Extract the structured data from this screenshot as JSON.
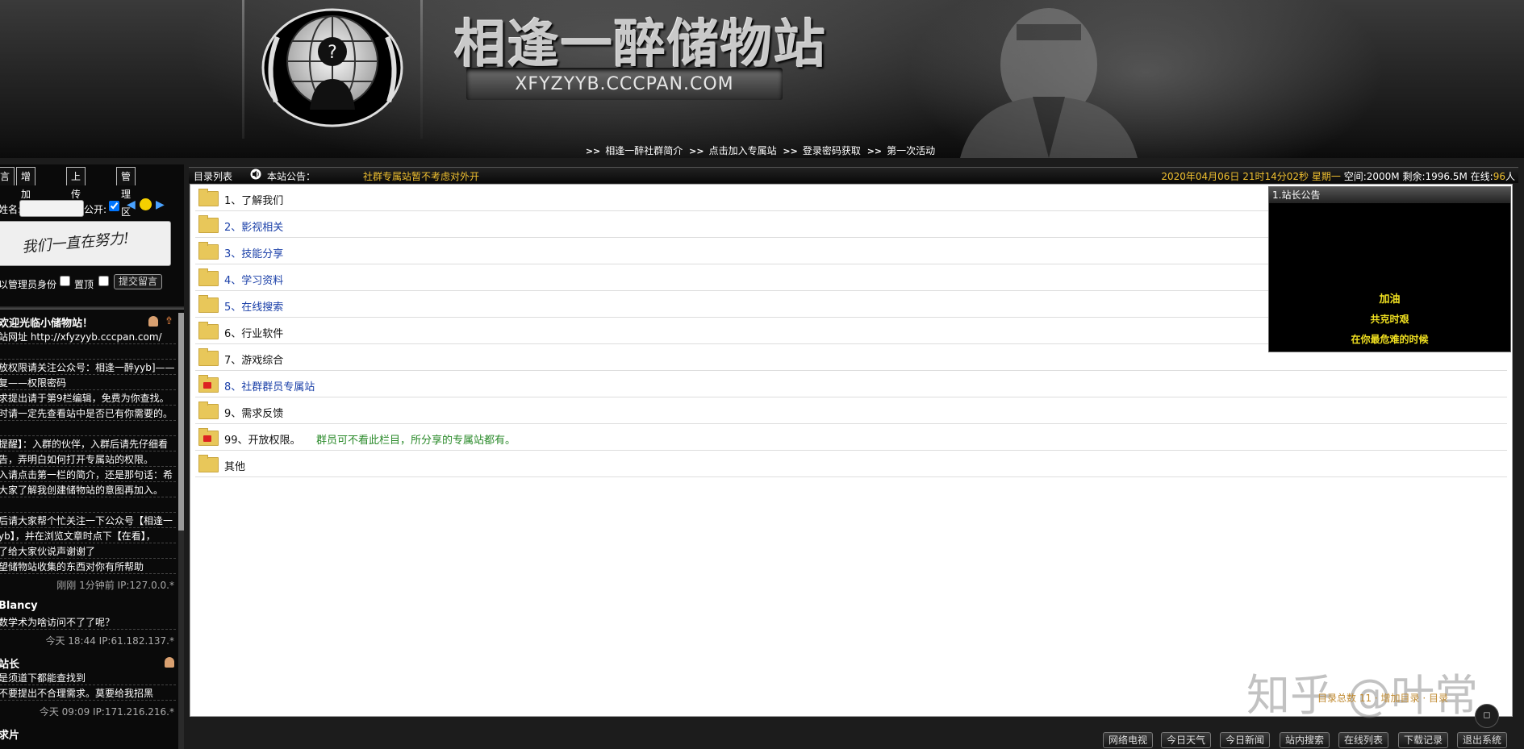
{
  "header": {
    "site_title": "相逢一醉储物站",
    "site_domain": "XFYZYYB.CCCPAN.COM",
    "nav": [
      {
        "label": "相逢一醉社群简介"
      },
      {
        "label": "点击加入专属站"
      },
      {
        "label": "登录密码获取"
      },
      {
        "label": "第一次活动"
      }
    ]
  },
  "left_panel": {
    "tabs": [
      "言",
      "增加目录",
      "上传文件",
      "管理区"
    ],
    "form": {
      "name_label": "姓名:",
      "name_value": "",
      "public_label": "公开:",
      "public_checked": true,
      "message_image_text": "我们一直在努力!",
      "admin_label": "以管理员身份",
      "top_label": "置顶",
      "submit_label": "提交留言"
    },
    "messages": [
      {
        "title": "欢迎光临小储物站！",
        "lines": [
          "站网址 http://xfyzyyb.cccpan.com/",
          "",
          "放权限请关注公众号：相逢一醉yyb]——",
          "复——权限密码",
          "求提出请于第9栏编辑，免费为你查找。",
          "时请一定先查看站中是否已有你需要的。",
          "",
          "提醒】：入群的伙伴，入群后请先仔细看",
          "告，弄明白如何打开专属站的权限。",
          "入请点击第一栏的简介，还是那句话：希",
          "大家了解我创建储物站的意图再加入。",
          "",
          "后请大家帮个忙关注一下公众号【相逢一",
          "yb】，并在浏览文章时点下【在看】，",
          "了给大家伙说声谢谢了",
          "望储物站收集的东西对你有所帮助"
        ],
        "meta": "刚刚 1分钟前 IP:127.0.0.*"
      },
      {
        "title": "Blancy",
        "lines": [
          "数学术为啥访问不了了呢？"
        ],
        "meta": "今天 18:44 IP:61.182.137.*"
      },
      {
        "title": "站长",
        "lines": [
          "是须道下都能查找到",
          "不要提出不合理需求。莫要给我招黑"
        ],
        "meta": "今天 09:09 IP:171.216.216.*"
      },
      {
        "title": "求片",
        "lines": [],
        "meta": ""
      }
    ]
  },
  "main": {
    "dir_list_label": "目录列表",
    "notice_label": "本站公告：",
    "notice_text": "社群专属站暂不考虑对外开",
    "status": {
      "datetime": "2020年04月06日 21时14分02秒 星期一",
      "space": "空间:2000M 剩余:1996.5M 在线:",
      "online": "96",
      "online_unit": "人"
    },
    "directories": [
      {
        "label": "1、了解我们",
        "style": "black",
        "locked": false,
        "note": ""
      },
      {
        "label": "2、影视相关",
        "style": "blue",
        "locked": false,
        "note": ""
      },
      {
        "label": "3、技能分享",
        "style": "blue",
        "locked": false,
        "note": ""
      },
      {
        "label": "4、学习资料",
        "style": "blue",
        "locked": false,
        "note": ""
      },
      {
        "label": "5、在线搜索",
        "style": "blue",
        "locked": false,
        "note": ""
      },
      {
        "label": "6、行业软件",
        "style": "black",
        "locked": false,
        "note": ""
      },
      {
        "label": "7、游戏综合",
        "style": "black",
        "locked": false,
        "note": ""
      },
      {
        "label": "8、社群群员专属站",
        "style": "blue",
        "locked": true,
        "note": ""
      },
      {
        "label": "9、需求反馈",
        "style": "black",
        "locked": false,
        "note": ""
      },
      {
        "label": "99、开放权限。",
        "style": "black",
        "locked": true,
        "note": "群员可不看此栏目，所分享的专属站都有。"
      },
      {
        "label": "其他",
        "style": "black",
        "locked": false,
        "note": ""
      }
    ],
    "notice_panel": {
      "header": "1.站长公告",
      "lines": [
        "加油",
        "共克时艰",
        "在你最危难的时候"
      ]
    },
    "stats_text": "目录总数 11  ·  增加目录  ·  目录",
    "watermark": "知乎 @叶常",
    "round_button_icon": "square-icon"
  },
  "footer": {
    "buttons": [
      "网络电视",
      "今日天气",
      "今日新闻",
      "站内搜索",
      "在线列表",
      "下载记录",
      "退出系统"
    ]
  },
  "colors": {
    "accent_gold": "#f0c030",
    "link_blue": "#1a3fa8",
    "note_green": "#2a8a2a",
    "folder_yellow": "#e8c75a"
  }
}
